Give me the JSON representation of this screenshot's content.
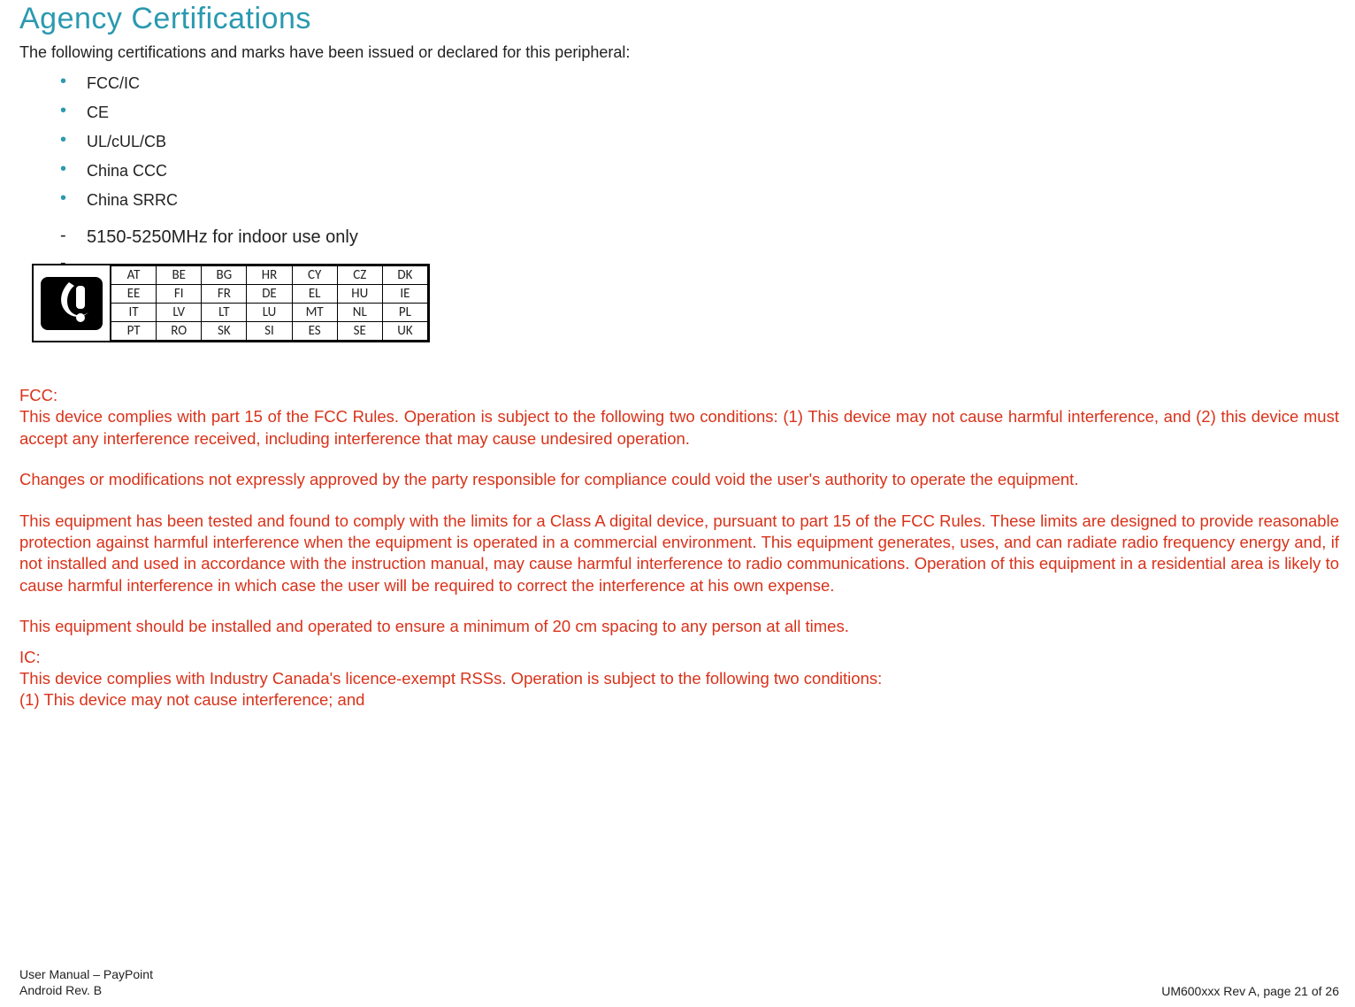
{
  "heading": "Agency Certifications",
  "intro": "The following certifications and marks have been issued or declared for this peripheral:",
  "cert_items": [
    "FCC/IC",
    "CE",
    "UL/cUL/CB",
    "China CCC",
    "China SRRC"
  ],
  "dash_items": [
    "5150-5250MHz for indoor use only",
    ""
  ],
  "country_rows": [
    [
      "AT",
      "BE",
      "BG",
      "HR",
      "CY",
      "CZ",
      "DK"
    ],
    [
      "EE",
      "FI",
      "FR",
      "DE",
      "EL",
      "HU",
      "IE"
    ],
    [
      "IT",
      "LV",
      "LT",
      "LU",
      "MT",
      "NL",
      "PL"
    ],
    [
      "PT",
      "RO",
      "SK",
      "SI",
      "ES",
      "SE",
      "UK"
    ]
  ],
  "fcc": {
    "label": "FCC:",
    "p1": "This device complies with part 15 of the FCC Rules. Operation is subject to the following two conditions: (1) This device may not cause harmful interference, and (2) this device must accept any interference received, including interference that may cause undesired operation.",
    "p2": "Changes or modifications not expressly approved by the party responsible for compliance could void the user's authority to operate the equipment.",
    "p3": "This equipment has been tested and found to comply with the limits for a Class A digital device, pursuant to part 15 of the FCC Rules. These limits are designed to provide reasonable protection against harmful interference when the equipment is operated in a commercial environment. This equipment generates, uses, and can radiate radio frequency energy and, if not installed and used in accordance with the instruction manual, may cause harmful interference to radio communications. Operation of this equipment in a residential area is likely to cause harmful interference in which case the user will be required to correct the interference at his own expense.",
    "p4": "This equipment should be installed and operated to ensure a minimum of 20 cm spacing to any person at all times."
  },
  "ic": {
    "label": "IC:",
    "p1": "This device complies with Industry Canada's licence-exempt RSSs. Operation is subject to the following two conditions:",
    "p2": "(1) This device may not cause interference; and"
  },
  "footer": {
    "left1": "User Manual – PayPoint",
    "left2": "Android Rev. B",
    "right": "UM600xxx Rev A, page 21 of 26"
  }
}
